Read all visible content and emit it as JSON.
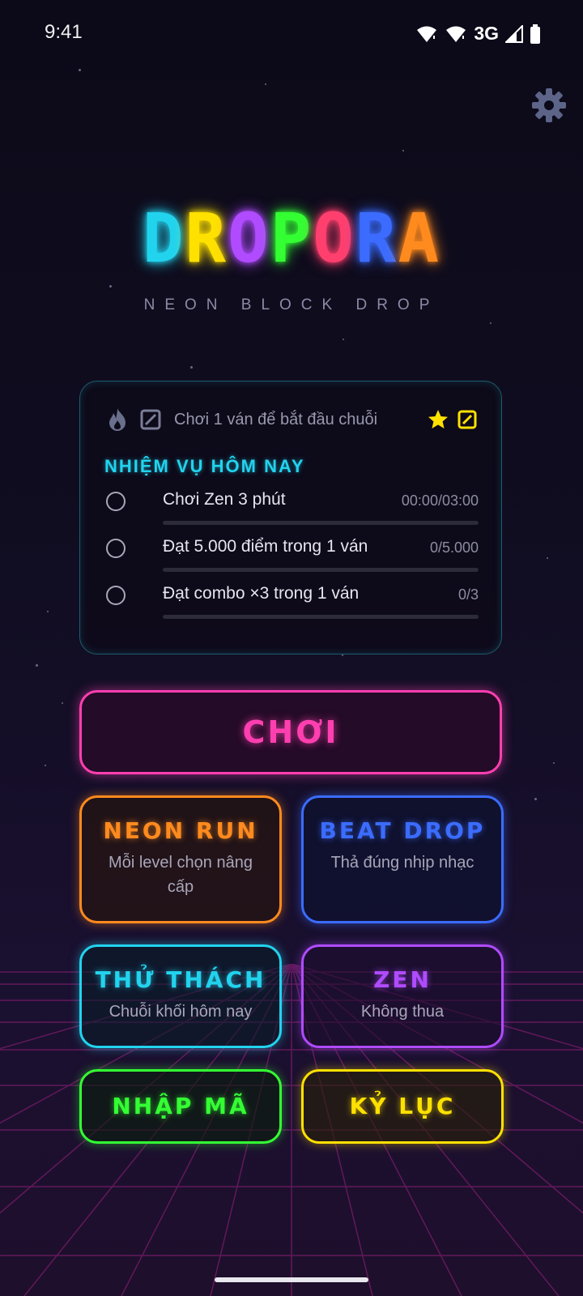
{
  "status_bar": {
    "time": "9:41",
    "network": "3G"
  },
  "logo": {
    "letters": [
      {
        "char": "D",
        "color": "#22d3ee"
      },
      {
        "char": "R",
        "color": "#ffe100"
      },
      {
        "char": "O",
        "color": "#b04bff"
      },
      {
        "char": "P",
        "color": "#33ff33"
      },
      {
        "char": "O",
        "color": "#ff3f6e"
      },
      {
        "char": "R",
        "color": "#3b6cff"
      },
      {
        "char": "A",
        "color": "#ff8a1e"
      }
    ],
    "subtitle": "NEON BLOCK DROP"
  },
  "streak": {
    "text": "Chơi 1 ván để bắt đầu chuỗi"
  },
  "quests": {
    "title": "NHIỆM VỤ HÔM NAY",
    "items": [
      {
        "label": "Chơi Zen 3 phút",
        "progress": "00:00/03:00",
        "fraction": 0
      },
      {
        "label": "Đạt 5.000 điểm trong 1 ván",
        "progress": "0/5.000",
        "fraction": 0
      },
      {
        "label": "Đạt combo ×3 trong 1 ván",
        "progress": "0/3",
        "fraction": 0
      }
    ]
  },
  "buttons": {
    "play": "CHƠI",
    "neon_run": {
      "title": "NEON RUN",
      "subtitle": "Mỗi level chọn nâng cấp"
    },
    "beat_drop": {
      "title": "BEAT DROP",
      "subtitle": "Thả đúng nhịp nhạc"
    },
    "challenge": {
      "title": "THỬ THÁCH",
      "subtitle": "Chuỗi khối hôm nay"
    },
    "zen": {
      "title": "ZEN",
      "subtitle": "Không thua"
    },
    "enter_code": "NHẬP MÃ",
    "records": "KỶ LỤC"
  },
  "colors": {
    "pink": "#ff3fb0",
    "orange": "#ff8a1e",
    "blue": "#3b6cff",
    "cyan": "#22d3ee",
    "purple": "#b04bff",
    "green": "#33ff33",
    "yellow": "#ffe100"
  }
}
